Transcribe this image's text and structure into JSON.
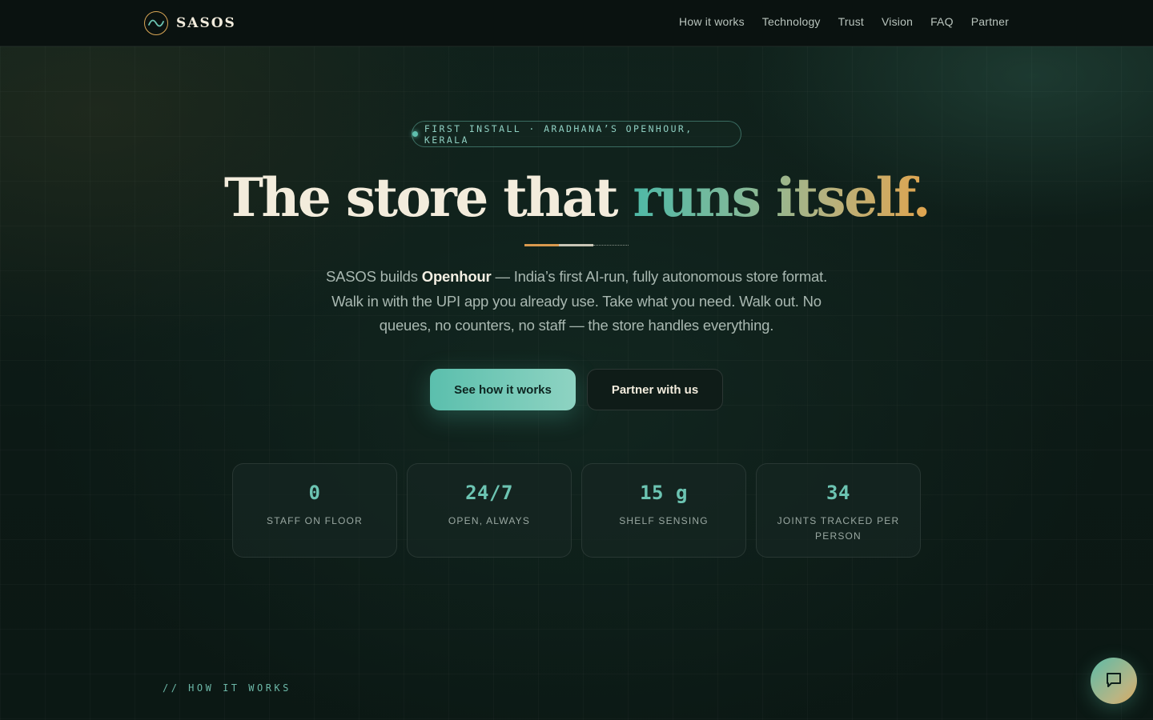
{
  "nav": {
    "brand": "SASOS",
    "links": [
      {
        "label": "How it works"
      },
      {
        "label": "Technology"
      },
      {
        "label": "Trust"
      },
      {
        "label": "Vision"
      },
      {
        "label": "FAQ"
      },
      {
        "label": "Partner"
      }
    ]
  },
  "hero": {
    "pill": "FIRST INSTALL · ARADHANA’S OPENHOUR, KERALA",
    "headline_main": "The store that ",
    "headline_accent": "runs itself.",
    "lede_pre": "SASOS builds ",
    "lede_bold": "Openhour",
    "lede_post": " — India’s first AI-run, fully autonomous store format. Walk in with the UPI app you already use. Take what you need. Walk out. No queues, no counters, no staff — the store handles everything.",
    "primary_cta": "See how it works",
    "secondary_cta": "Partner with us"
  },
  "stats": [
    {
      "value": "0",
      "label": "STAFF ON FLOOR"
    },
    {
      "value": "24/7",
      "label": "OPEN, ALWAYS"
    },
    {
      "value": "15 g",
      "label": "SHELF SENSING"
    },
    {
      "value": "34",
      "label": "JOINTS TRACKED PER PERSON"
    }
  ],
  "section_tag": "// HOW IT WORKS",
  "colors": {
    "accent": "#5fbfae",
    "gold": "#d99a4e",
    "background": "#0d1a16"
  },
  "icons": {
    "logo": "wave-logo-icon",
    "chat": "chat-bubble-icon"
  }
}
